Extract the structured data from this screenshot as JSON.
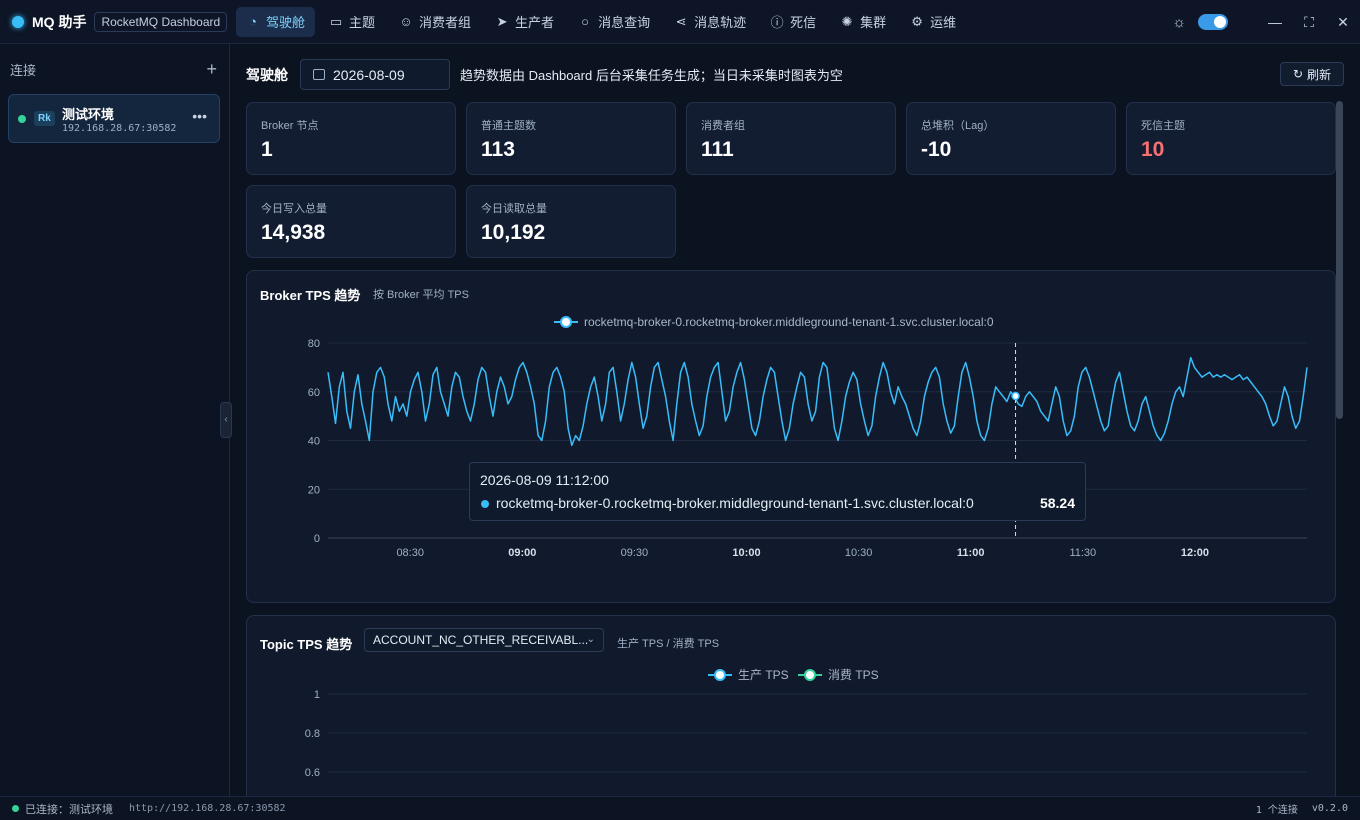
{
  "app": {
    "name": "MQ 助手",
    "tag": "RocketMQ Dashboard"
  },
  "nav": [
    {
      "label": "驾驶舱",
      "icon": "gauge-icon",
      "active": true
    },
    {
      "label": "主题",
      "icon": "folder-icon"
    },
    {
      "label": "消费者组",
      "icon": "user-icon"
    },
    {
      "label": "生产者",
      "icon": "send-icon"
    },
    {
      "label": "消息查询",
      "icon": "search-icon"
    },
    {
      "label": "消息轨迹",
      "icon": "share-icon"
    },
    {
      "label": "死信",
      "icon": "alert-circle-icon"
    },
    {
      "label": "集群",
      "icon": "cluster-icon"
    },
    {
      "label": "运维",
      "icon": "gear-icon"
    }
  ],
  "sidebar": {
    "title": "连接",
    "connection": {
      "badge": "Rk",
      "name": "测试环境",
      "address": "192.168.28.67:30582"
    }
  },
  "page": {
    "title": "驾驶舱",
    "date": "2026-08-09",
    "hint": "趋势数据由 Dashboard 后台采集任务生成；当日未采集时图表为空",
    "refresh_label": "刷新"
  },
  "stats": [
    {
      "label": "Broker 节点",
      "value": "1"
    },
    {
      "label": "普通主题数",
      "value": "113"
    },
    {
      "label": "消费者组",
      "value": "111"
    },
    {
      "label": "总堆积（Lag）",
      "value": "-10"
    },
    {
      "label": "死信主题",
      "value": "10",
      "highlight": true
    },
    {
      "label": "今日写入总量",
      "value": "14,938"
    },
    {
      "label": "今日读取总量",
      "value": "10,192"
    }
  ],
  "broker_panel": {
    "title": "Broker TPS 趋势",
    "subtitle": "按 Broker 平均 TPS",
    "tooltip": {
      "time": "2026-08-09 11:12:00",
      "series": "rocketmq-broker-0.rocketmq-broker.middleground-tenant-1.svc.cluster.local:0",
      "value": "58.24"
    }
  },
  "topic_panel": {
    "title": "Topic TPS 趋势",
    "selected_topic": "ACCOUNT_NC_OTHER_RECEIVABL...",
    "subtitle": "生产 TPS / 消费 TPS"
  },
  "chart_data": [
    {
      "type": "line",
      "ylim": [
        0,
        80
      ],
      "yticks": [
        "80",
        "60",
        "40",
        "20",
        "0"
      ],
      "xticks": [
        "08:30",
        "09:00",
        "09:30",
        "10:00",
        "10:30",
        "11:00",
        "11:30",
        "12:00"
      ],
      "xticks_bold": [
        false,
        true,
        false,
        true,
        false,
        true,
        false,
        true
      ],
      "x_range": [
        "08:08",
        "12:30"
      ],
      "series": [
        {
          "name": "rocketmq-broker-0.rocketmq-broker.middleground-tenant-1.svc.cluster.local:0",
          "color": "#38bdf8",
          "values": [
            68,
            58,
            47,
            62,
            68,
            52,
            45,
            60,
            67,
            55,
            48,
            40,
            60,
            68,
            70,
            66,
            55,
            48,
            58,
            52,
            55,
            50,
            60,
            65,
            68,
            60,
            48,
            55,
            67,
            70,
            60,
            55,
            50,
            62,
            68,
            66,
            58,
            52,
            48,
            55,
            65,
            70,
            68,
            58,
            50,
            60,
            66,
            62,
            55,
            58,
            65,
            70,
            72,
            68,
            62,
            55,
            42,
            40,
            48,
            62,
            68,
            70,
            66,
            60,
            45,
            38,
            42,
            40,
            46,
            55,
            62,
            66,
            58,
            48,
            55,
            68,
            70,
            60,
            48,
            55,
            65,
            72,
            66,
            55,
            45,
            50,
            62,
            70,
            72,
            65,
            58,
            48,
            40,
            55,
            68,
            72,
            66,
            55,
            48,
            42,
            46,
            58,
            66,
            70,
            72,
            60,
            48,
            52,
            62,
            68,
            72,
            65,
            55,
            45,
            42,
            48,
            58,
            65,
            70,
            68,
            58,
            48,
            40,
            45,
            55,
            62,
            68,
            66,
            55,
            48,
            52,
            66,
            72,
            70,
            58,
            45,
            40,
            48,
            58,
            64,
            68,
            65,
            55,
            48,
            42,
            46,
            58,
            66,
            72,
            68,
            60,
            55,
            62,
            58,
            55,
            50,
            45,
            42,
            48,
            58,
            64,
            68,
            70,
            66,
            55,
            48,
            43,
            46,
            58,
            68,
            72,
            66,
            58,
            48,
            42,
            40,
            45,
            55,
            62,
            60,
            58,
            56,
            60,
            58,
            55,
            54,
            58,
            60,
            58,
            56,
            52,
            50,
            48,
            55,
            62,
            58,
            48,
            42,
            44,
            50,
            62,
            68,
            70,
            66,
            60,
            54,
            48,
            44,
            46,
            56,
            64,
            68,
            60,
            52,
            46,
            44,
            48,
            55,
            58,
            52,
            46,
            42,
            40,
            43,
            48,
            55,
            60,
            62,
            58,
            66,
            74,
            70,
            68,
            66,
            67,
            68,
            66,
            67,
            66,
            67,
            66,
            65,
            66,
            67,
            65,
            66,
            64,
            62,
            60,
            58,
            55,
            50,
            46,
            48,
            55,
            62,
            58,
            50,
            45,
            48,
            58,
            70
          ]
        }
      ],
      "hover_x": "11:12",
      "hover_value": 58.24
    },
    {
      "type": "line",
      "ylim": [
        0,
        1
      ],
      "yticks": [
        "1",
        "0.8",
        "0.6"
      ],
      "series": [
        {
          "name": "生产 TPS",
          "color": "#38bdf8",
          "values": []
        },
        {
          "name": "消费 TPS",
          "color": "#34d399",
          "values": []
        }
      ]
    }
  ],
  "statusbar": {
    "status": "已连接：测试环境",
    "url": "http://192.168.28.67:30582",
    "connections": "1 个连接",
    "version": "v0.2.0"
  }
}
